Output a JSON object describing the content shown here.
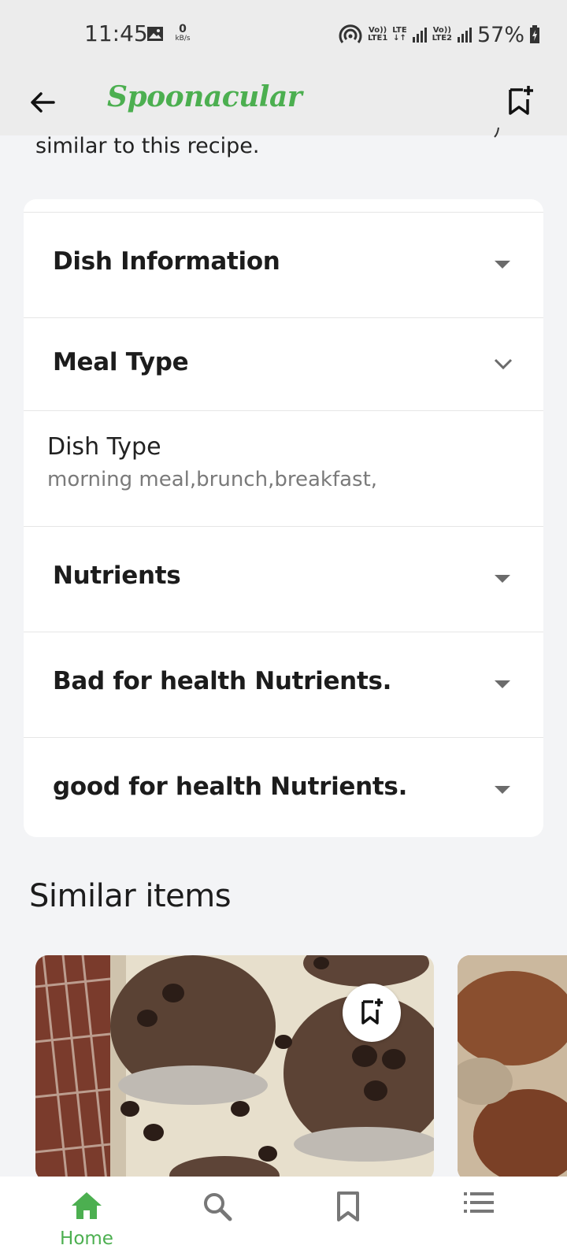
{
  "status_bar": {
    "time": "11:45",
    "speed_value": "0",
    "speed_unit": "kB/s",
    "sim1_top": "Vo))",
    "sim1_bottom": "LTE1",
    "lte_label": "LTE",
    "sim2_top": "Vo))",
    "sim2_bottom": "LTE2",
    "battery": "57%"
  },
  "app_bar": {
    "title": "Spoonacular"
  },
  "intro": {
    "truncated_text": "similar to this recipe."
  },
  "sections": {
    "dish_information": "Dish Information",
    "meal_type": "Meal Type",
    "dish_type_label": "Dish Type",
    "dish_type_value": "morning meal,brunch,breakfast,",
    "nutrients": "Nutrients",
    "bad_nutrients": "Bad for health Nutrients.",
    "good_nutrients": "good for health Nutrients."
  },
  "similar": {
    "title": "Similar items"
  },
  "bottom_nav": {
    "home_label": "Home"
  },
  "colors": {
    "accent": "#4caf50",
    "appbar_bg": "#ececec",
    "page_bg": "#f3f4f6"
  }
}
